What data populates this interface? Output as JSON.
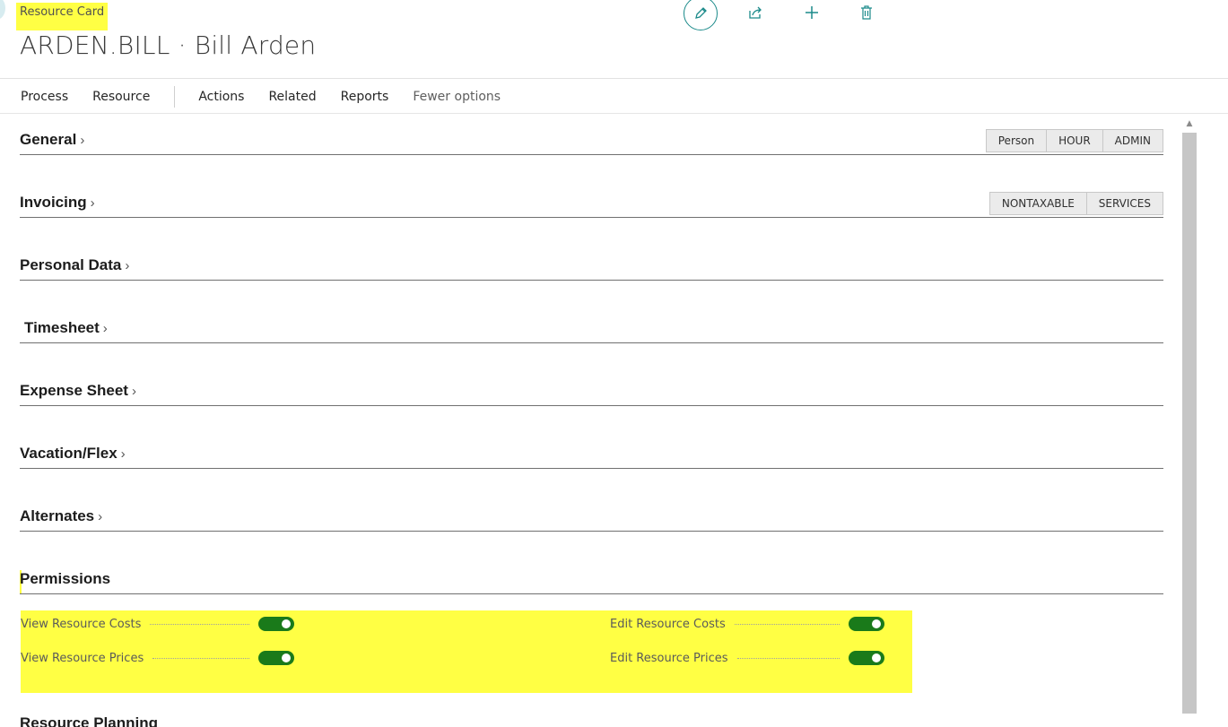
{
  "header": {
    "caption": "Resource Card",
    "record_title": "ARDEN.BILL · Bill Arden"
  },
  "toolbar_icons": [
    "edit-icon",
    "share-icon",
    "plus-icon",
    "delete-icon"
  ],
  "actions": {
    "process": "Process",
    "resource": "Resource",
    "actions": "Actions",
    "related": "Related",
    "reports": "Reports",
    "fewer": "Fewer options"
  },
  "sections": {
    "general": {
      "title": "General",
      "chips": [
        "Person",
        "HOUR",
        "ADMIN"
      ]
    },
    "invoicing": {
      "title": "Invoicing",
      "chips": [
        "NONTAXABLE",
        "SERVICES"
      ]
    },
    "personal": {
      "title": "Personal Data"
    },
    "timesheet": {
      "title": "Timesheet"
    },
    "expense": {
      "title": "Expense Sheet"
    },
    "vacation": {
      "title": "Vacation/Flex"
    },
    "alternates": {
      "title": "Alternates"
    },
    "permissions": {
      "title": "Permissions",
      "fields": {
        "view_costs": {
          "label": "View Resource Costs",
          "value": true
        },
        "view_prices": {
          "label": "View Resource Prices",
          "value": true
        },
        "edit_costs": {
          "label": "Edit Resource Costs",
          "value": true
        },
        "edit_prices": {
          "label": "Edit Resource Prices",
          "value": true
        }
      }
    },
    "planning": {
      "title": "Resource Planning"
    }
  },
  "colors": {
    "highlight": "#ffff44",
    "accent": "#1b8a8a",
    "toggle_on": "#1a7a1a"
  }
}
